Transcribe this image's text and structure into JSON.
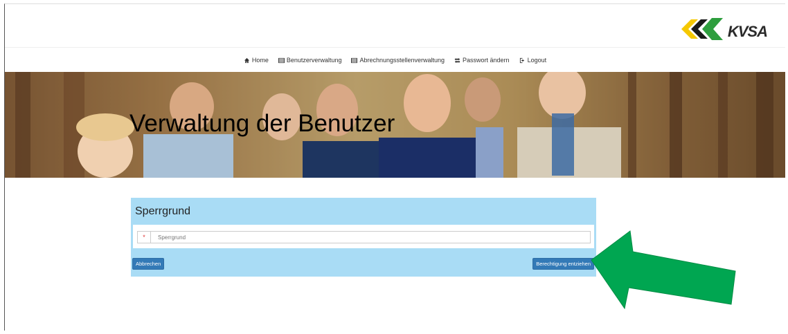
{
  "brand": {
    "logo_text": "KVSA"
  },
  "nav": {
    "items": [
      {
        "label": "Home",
        "icon": "home-icon"
      },
      {
        "label": "Benutzerverwaltung",
        "icon": "list-icon"
      },
      {
        "label": "Abrechnungsstellenverwaltung",
        "icon": "list-icon"
      },
      {
        "label": "Passwort ändern",
        "icon": "retweet-icon"
      },
      {
        "label": "Logout",
        "icon": "logout-icon"
      }
    ]
  },
  "banner": {
    "title": "Verwaltung der Benutzer"
  },
  "form": {
    "title": "Sperrgrund",
    "required_marker": "*",
    "input_placeholder": "Sperrgrund",
    "input_value": "",
    "cancel_label": "Abbrechen",
    "submit_label": "Berechtigung entziehen"
  },
  "colors": {
    "panel": "#a9dcf5",
    "button": "#337ab7",
    "arrow": "#00a651"
  }
}
